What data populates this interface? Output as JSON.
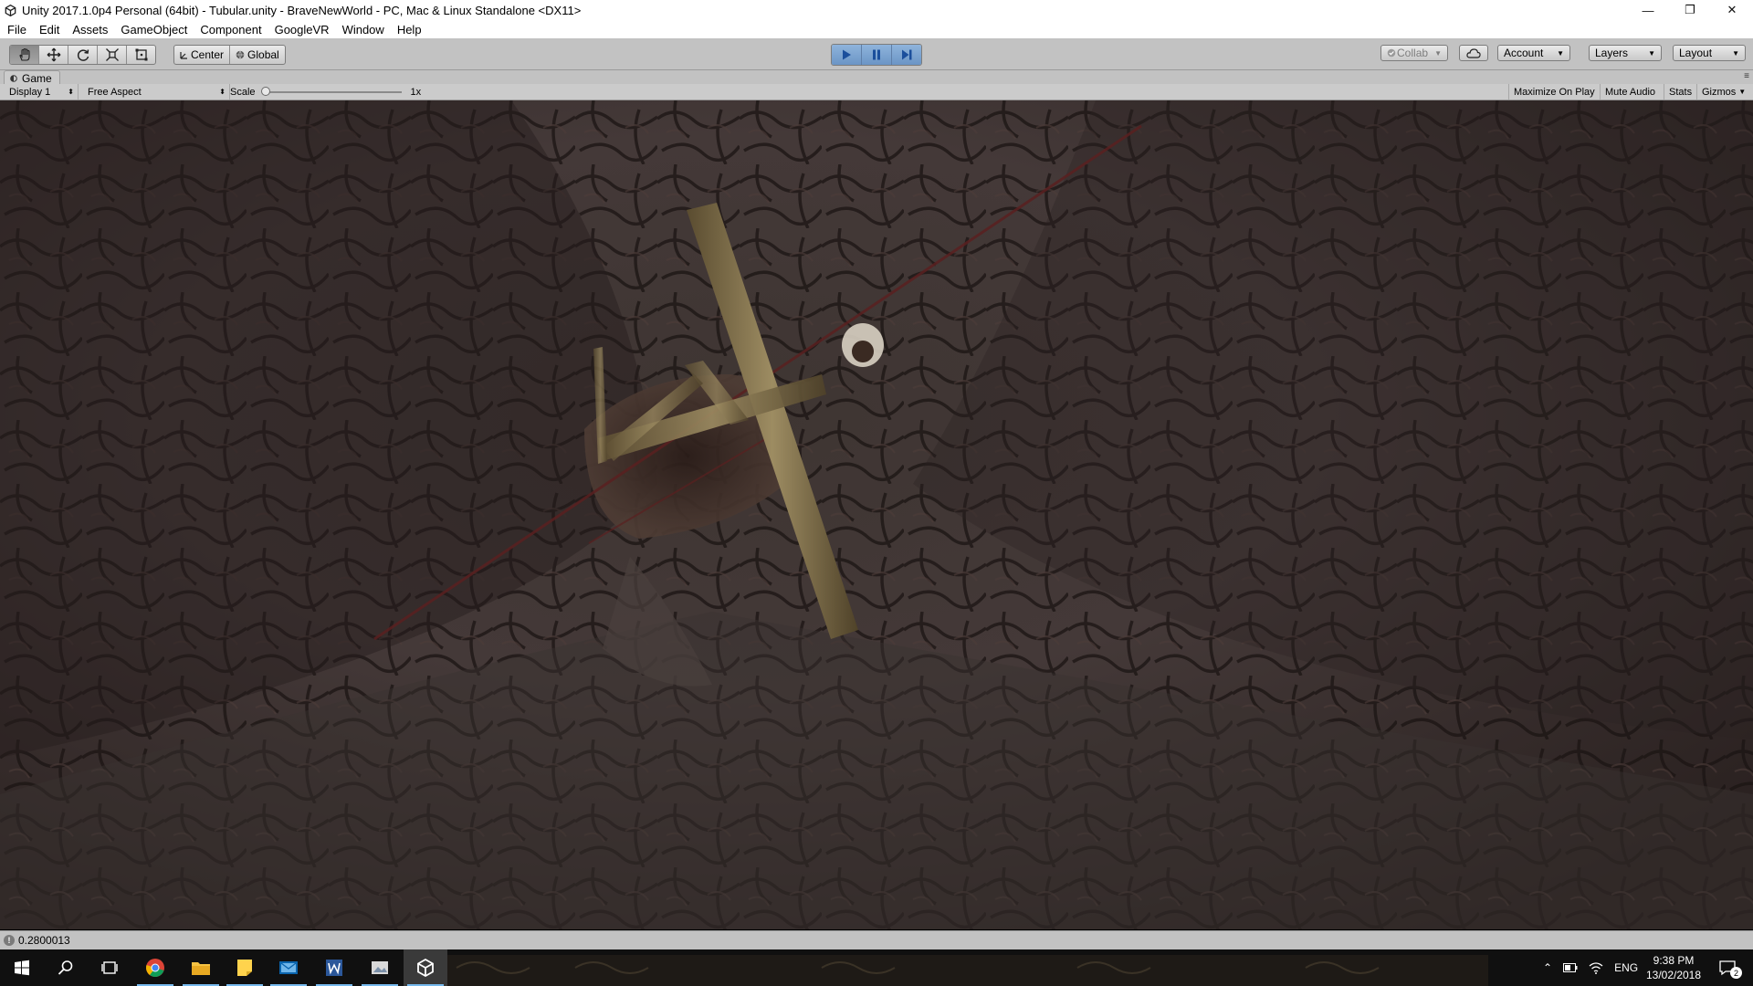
{
  "window": {
    "title": "Unity 2017.1.0p4 Personal (64bit) - Tubular.unity - BraveNewWorld - PC, Mac & Linux Standalone <DX11>",
    "minimize_glyph": "—",
    "maximize_glyph": "❐",
    "close_glyph": "✕"
  },
  "menu": {
    "items": [
      "File",
      "Edit",
      "Assets",
      "GameObject",
      "Component",
      "GoogleVR",
      "Window",
      "Help"
    ]
  },
  "toolbar": {
    "tools": [
      {
        "name": "hand-tool",
        "icon": "hand-icon"
      },
      {
        "name": "move-tool",
        "icon": "move-icon"
      },
      {
        "name": "rotate-tool",
        "icon": "rotate-icon"
      },
      {
        "name": "scale-tool",
        "icon": "scale-icon"
      },
      {
        "name": "rect-tool",
        "icon": "rect-icon"
      }
    ],
    "pivot_label": "Center",
    "space_label": "Global",
    "collab_label": "Collab",
    "account_label": "Account",
    "layers_label": "Layers",
    "layout_label": "Layout"
  },
  "game_tab": {
    "label": "Game"
  },
  "game_view": {
    "display": "Display 1",
    "aspect": "Free Aspect",
    "scale_label": "Scale",
    "scale_value": "1x",
    "maximize_on_play": "Maximize On Play",
    "mute_audio": "Mute Audio",
    "stats": "Stats",
    "gizmos": "Gizmos"
  },
  "status": {
    "message": "0.2800013"
  },
  "taskbar": {
    "language": "ENG",
    "time": "9:38 PM",
    "date": "13/02/2018",
    "notification_count": "2"
  },
  "colors": {
    "unity_chrome": "#c2c2c2",
    "play_blue": "#6b95c6",
    "taskbar": "#101010",
    "scene_rock": "#3a302e",
    "scene_wood": "#8a7a55"
  }
}
